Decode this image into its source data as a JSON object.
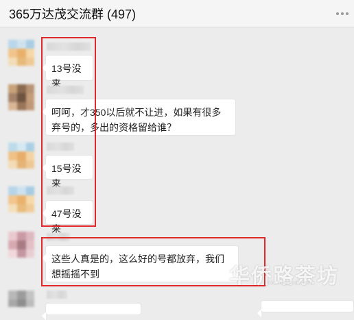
{
  "window": {
    "title": "365万达茂交流群 (497)"
  },
  "messages": [
    {
      "text": "13号没来"
    },
    {
      "text": "呵呵，才350以后就不让进，如果有很多弃号的，多出的资格留给谁？"
    },
    {
      "text": "15号没来"
    },
    {
      "text": "47号没来"
    },
    {
      "text": "这些人真是的，这么好的号都放弃，我们想摇摇不到"
    }
  ],
  "watermark": {
    "text": "华侨路茶坊",
    "url": "bbs.huaqiaolu.com"
  },
  "colors": {
    "highlight": "#e3262a",
    "background": "#ececec",
    "bubble": "#ffffff"
  }
}
